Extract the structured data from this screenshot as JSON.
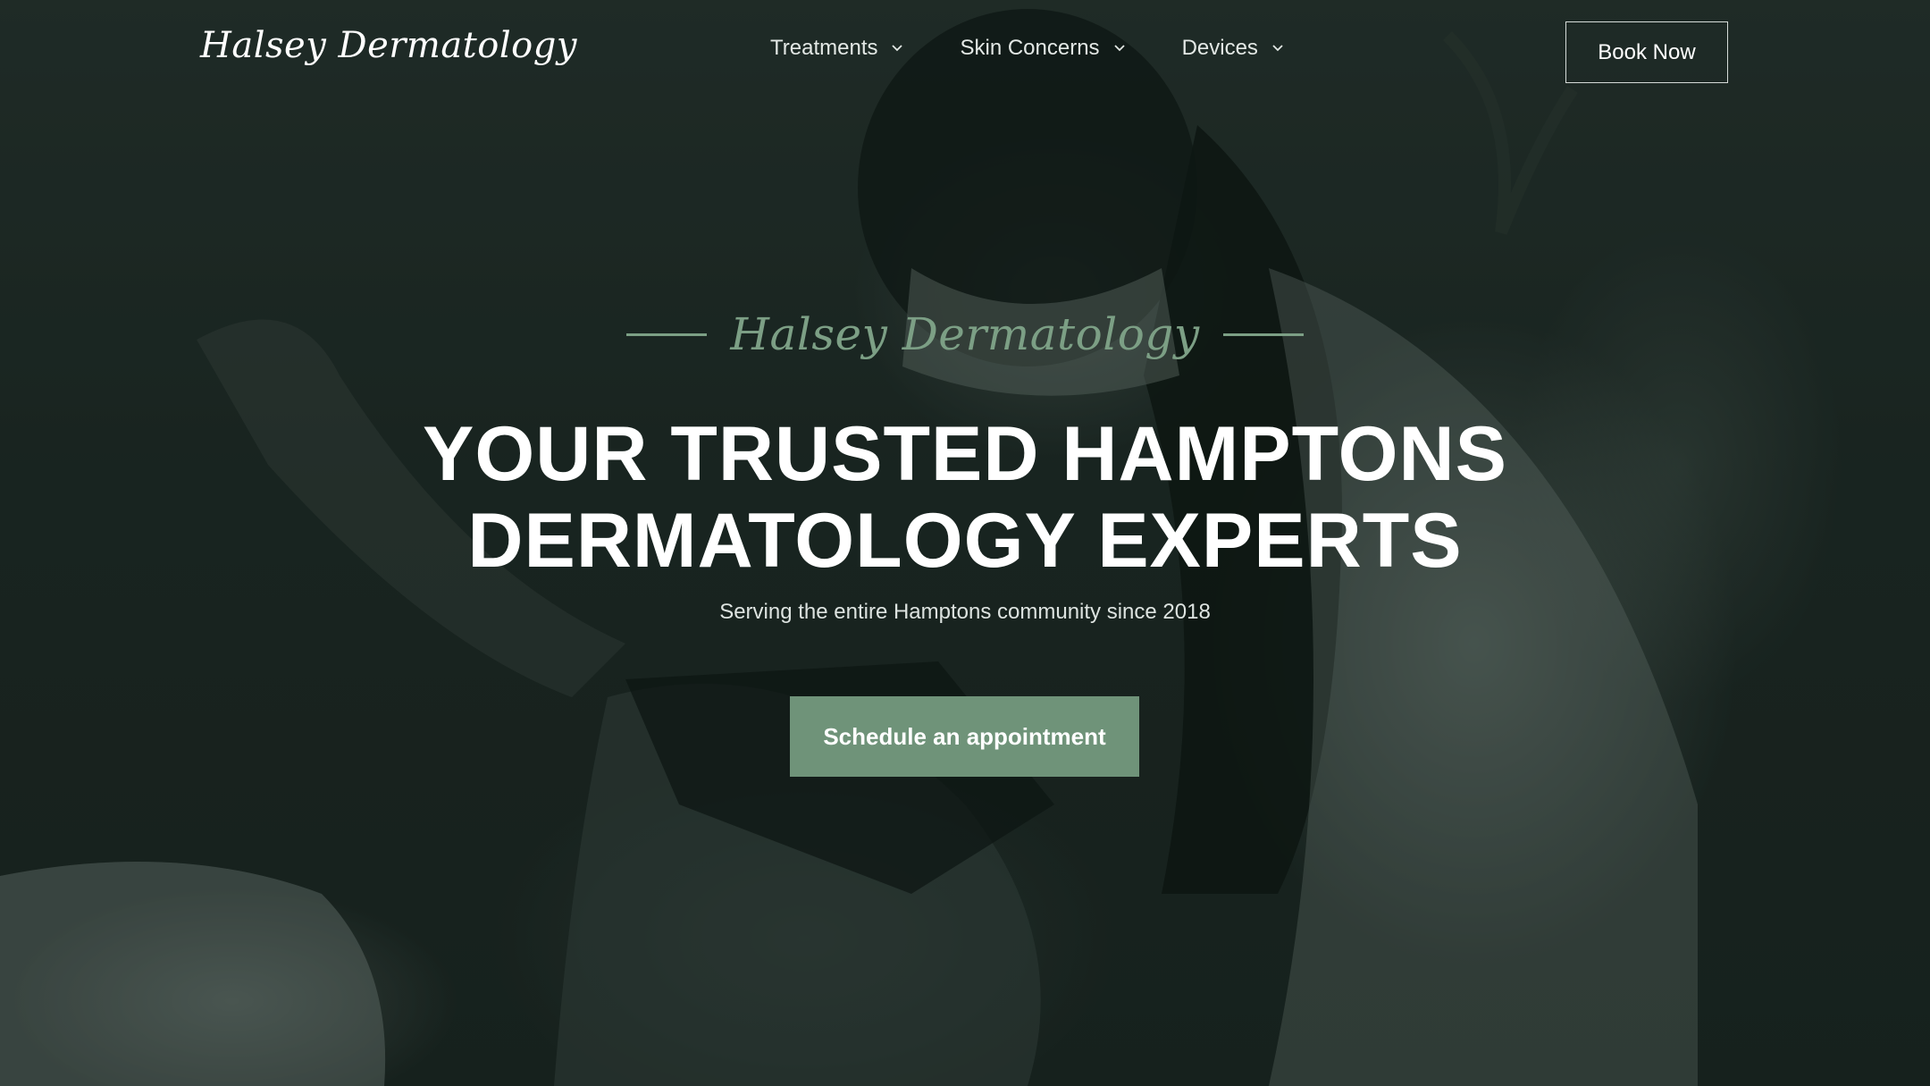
{
  "header": {
    "logo": "Halsey Dermatology",
    "nav": [
      {
        "label": "Treatments"
      },
      {
        "label": "Skin Concerns"
      },
      {
        "label": "Devices"
      }
    ],
    "book_label": "Book Now"
  },
  "hero": {
    "eyebrow": "Halsey Dermatology",
    "headline_line1": "YOUR TRUSTED HAMPTONS",
    "headline_line2": "DERMATOLOGY EXPERTS",
    "subtitle": "Serving the entire Hamptons community since 2018",
    "cta_label": "Schedule an appointment"
  },
  "colors": {
    "accent_green": "#7c9f85",
    "button_green": "#6f9379",
    "overlay": "#1a2421"
  }
}
